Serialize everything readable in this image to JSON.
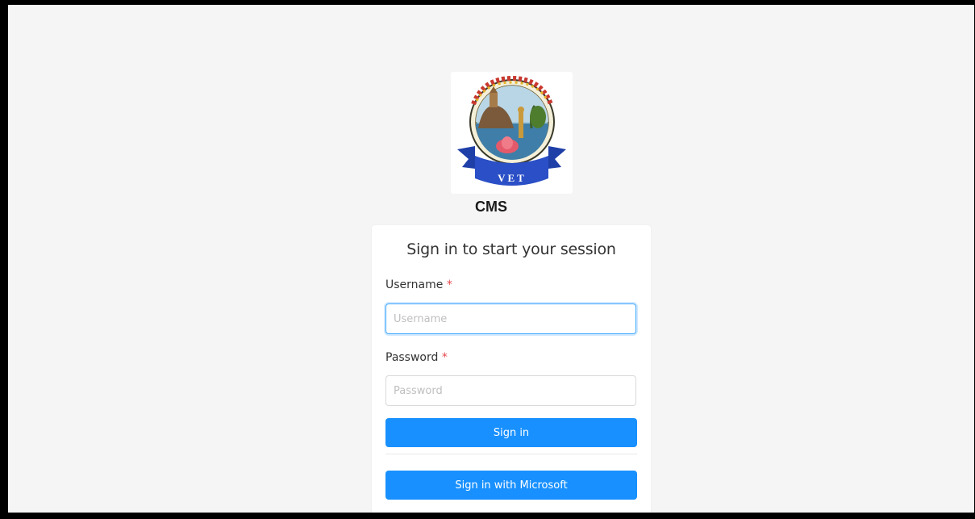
{
  "app": {
    "name": "CMS"
  },
  "logo": {
    "emblem_text": "VET"
  },
  "login": {
    "title": "Sign in to start your session",
    "username": {
      "label": "Username",
      "required_mark": "*",
      "placeholder": "Username",
      "value": ""
    },
    "password": {
      "label": "Password",
      "required_mark": "*",
      "placeholder": "Password",
      "value": ""
    },
    "sign_in_label": "Sign in",
    "microsoft_label": "Sign in with Microsoft"
  },
  "colors": {
    "primary": "#1890ff",
    "required": "#e5484d",
    "background": "#f5f5f5"
  }
}
